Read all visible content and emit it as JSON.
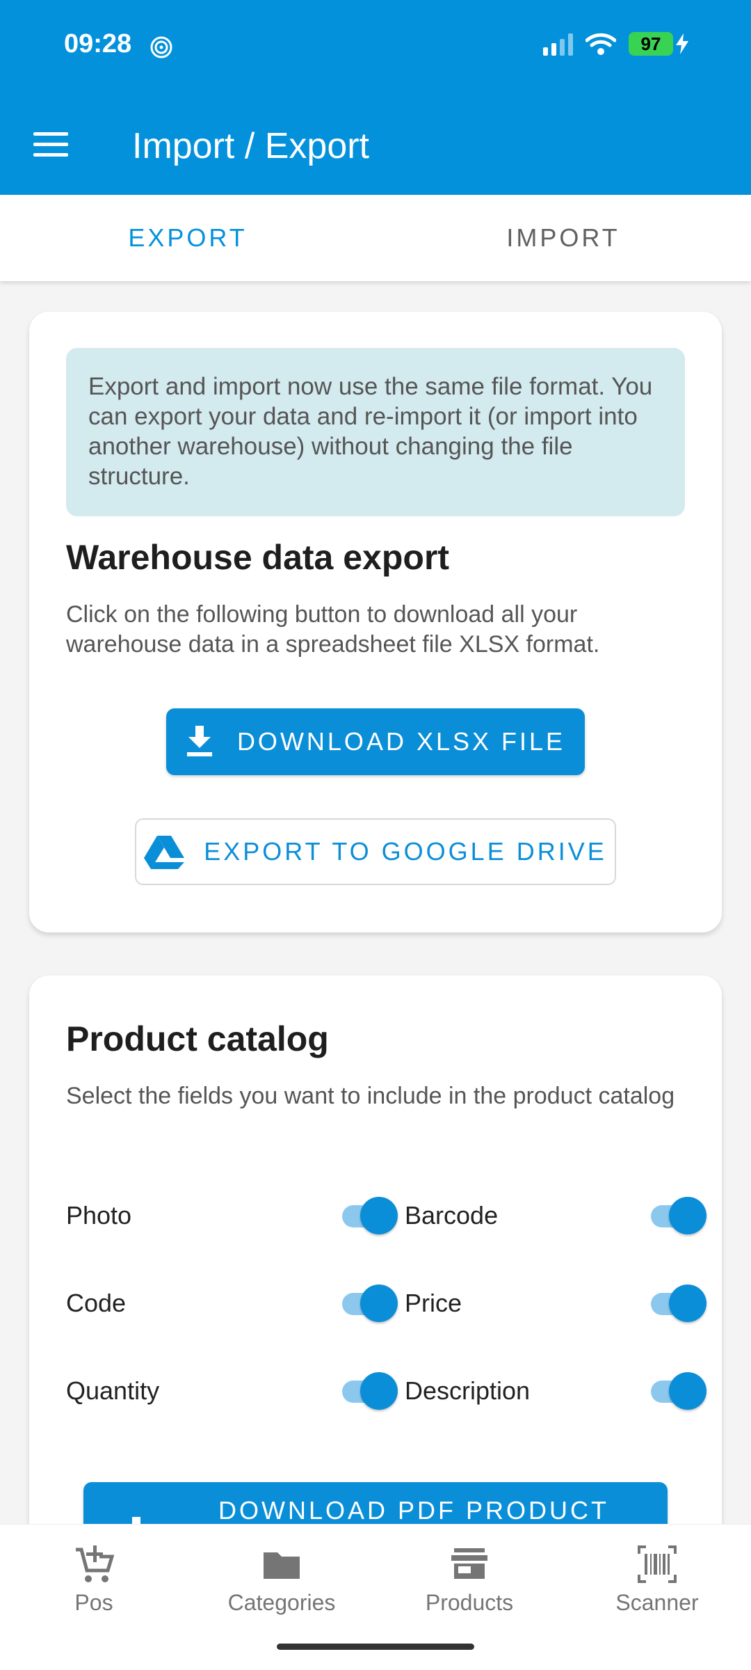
{
  "status": {
    "time": "09:28",
    "battery": "97"
  },
  "header": {
    "title": "Import / Export"
  },
  "tabs": [
    {
      "label": "EXPORT",
      "active": true
    },
    {
      "label": "IMPORT",
      "active": false
    }
  ],
  "export_card": {
    "info": "Export and import now use the same file format. You can export your data and re-import it (or import into another warehouse) without changing the file structure.",
    "title": "Warehouse data export",
    "description": "Click on the following button to download all your warehouse data in a spreadsheet file XLSX format.",
    "download_button": "DOWNLOAD XLSX FILE",
    "drive_button": "EXPORT TO GOOGLE DRIVE"
  },
  "catalog_card": {
    "title": "Product catalog",
    "description": "Select the fields you want to include in the product catalog",
    "fields": [
      {
        "label": "Photo",
        "enabled": true
      },
      {
        "label": "Barcode",
        "enabled": true
      },
      {
        "label": "Code",
        "enabled": true
      },
      {
        "label": "Price",
        "enabled": true
      },
      {
        "label": "Quantity",
        "enabled": true
      },
      {
        "label": "Description",
        "enabled": true
      }
    ],
    "pdf_button": "DOWNLOAD PDF PRODUCT"
  },
  "bottom_nav": [
    {
      "label": "Pos",
      "icon": "cart-add-icon"
    },
    {
      "label": "Categories",
      "icon": "folder-icon"
    },
    {
      "label": "Products",
      "icon": "store-icon"
    },
    {
      "label": "Scanner",
      "icon": "barcode-scan-icon"
    }
  ],
  "colors": {
    "primary": "#0391dc",
    "info_bg": "#d3eaef",
    "toggle_track": "#8cc8ee"
  }
}
